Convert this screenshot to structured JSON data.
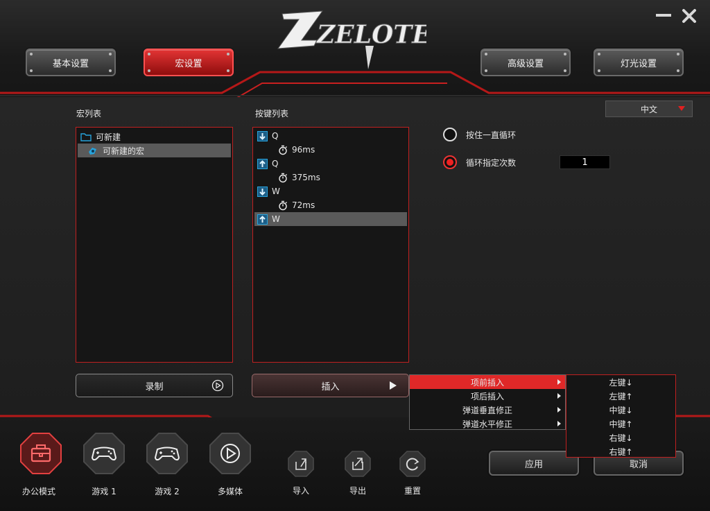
{
  "window": {
    "brand": "ZELOTES",
    "minimize_label": "—",
    "close_label": "✕"
  },
  "tabs": [
    {
      "label": "基本设置",
      "active": false
    },
    {
      "label": "宏设置",
      "active": true
    },
    {
      "label": "高级设置",
      "active": false
    },
    {
      "label": "灯光设置",
      "active": false
    }
  ],
  "macro_list": {
    "title": "宏列表",
    "folder": "可新建",
    "items": [
      "可新建的宏"
    ],
    "selected_item": "可新建的宏"
  },
  "key_list": {
    "title": "按键列表",
    "items": [
      {
        "type": "key-down",
        "text": "Q"
      },
      {
        "type": "delay",
        "text": "96ms"
      },
      {
        "type": "key-up",
        "text": "Q"
      },
      {
        "type": "delay",
        "text": "375ms"
      },
      {
        "type": "key-down",
        "text": "W"
      },
      {
        "type": "delay",
        "text": "72ms"
      },
      {
        "type": "key-up",
        "text": "W",
        "selected": true
      }
    ]
  },
  "buttons": {
    "record": "录制",
    "insert": "插入"
  },
  "language": {
    "selected": "中文"
  },
  "loop": {
    "hold_loop_label": "按住一直循环",
    "count_loop_label": "循环指定次数",
    "count_value": "1",
    "selected": "count"
  },
  "context_menu": {
    "items": [
      {
        "label": "项前插入",
        "highlighted": true
      },
      {
        "label": "项后插入",
        "highlighted": false
      },
      {
        "label": "弹道垂直修正",
        "highlighted": false
      },
      {
        "label": "弹道水平修正",
        "highlighted": false
      }
    ],
    "submenu": [
      "左键↓",
      "左键↑",
      "中键↓",
      "中键↑",
      "右键↓",
      "右键↑"
    ]
  },
  "modes": [
    {
      "label": "办公模式",
      "icon": "briefcase-icon",
      "active": true
    },
    {
      "label": "游戏 1",
      "icon": "gamepad-icon",
      "active": false
    },
    {
      "label": "游戏 2",
      "icon": "gamepad-icon",
      "active": false
    },
    {
      "label": "多媒体",
      "icon": "play-icon",
      "active": false
    }
  ],
  "file_actions": [
    {
      "label": "导入",
      "icon": "import-icon"
    },
    {
      "label": "导出",
      "icon": "export-icon"
    },
    {
      "label": "重置",
      "icon": "reset-icon"
    }
  ],
  "footer_buttons": {
    "apply": "应用",
    "cancel": "取消"
  },
  "colors": {
    "accent": "#e02828",
    "icon_blue": "#27a3dc"
  }
}
